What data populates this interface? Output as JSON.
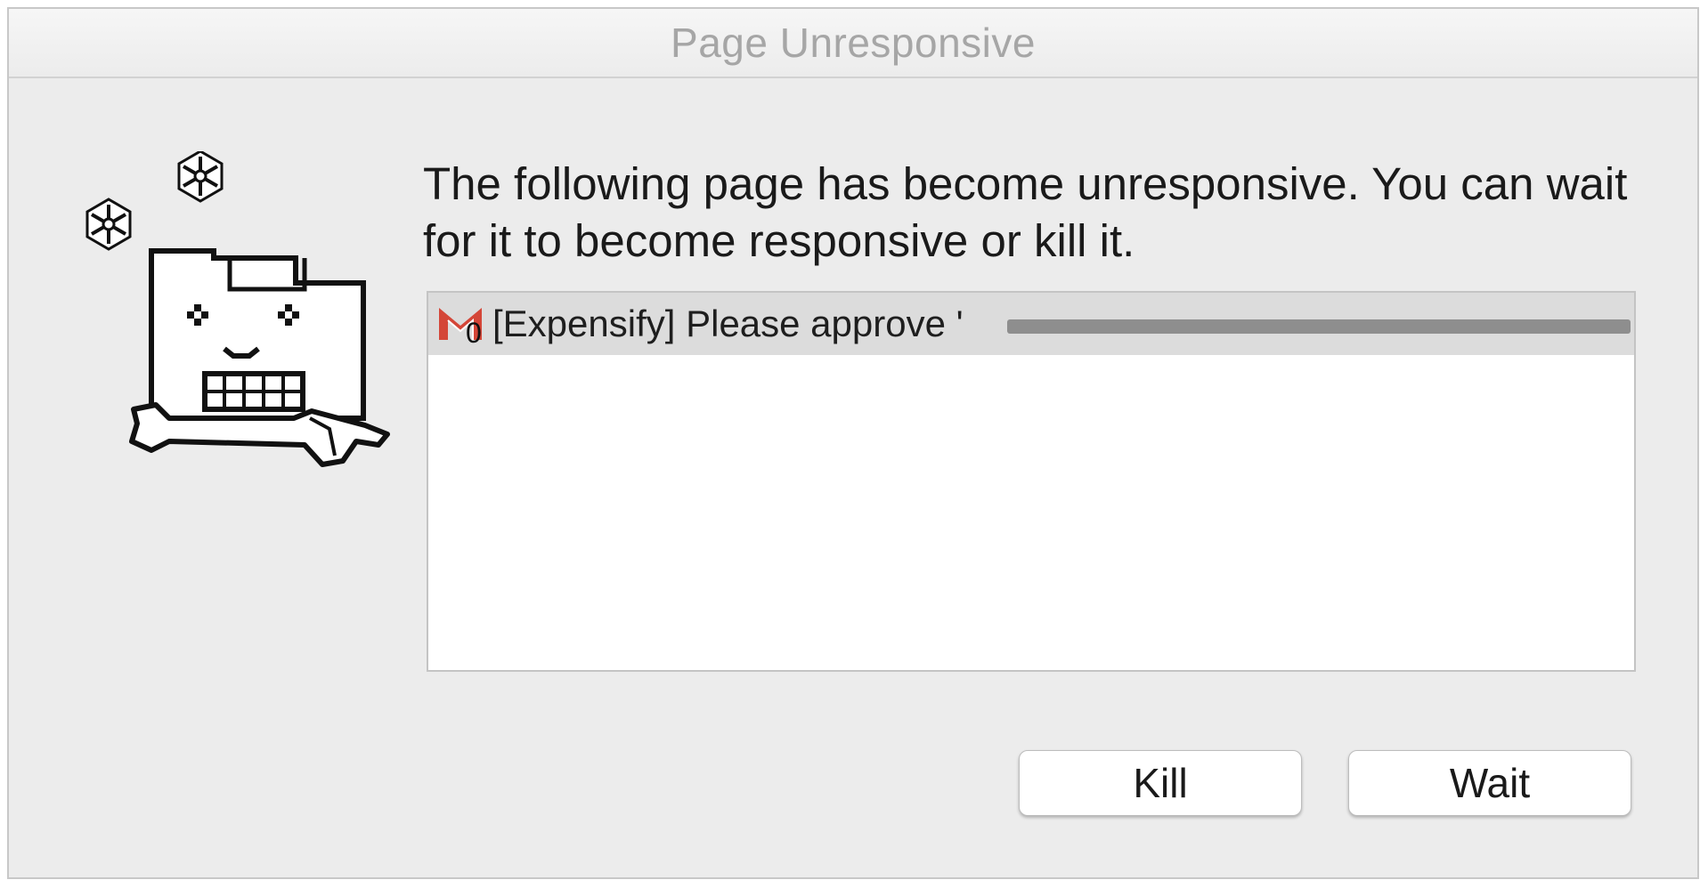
{
  "window": {
    "title": "Page Unresponsive"
  },
  "dialog": {
    "message": "The following page has become unresponsive. You can wait for it to become responsive or kill it.",
    "pages": [
      {
        "favicon": "gmail-icon",
        "badge": "0",
        "title": "[Expensify] Please approve '"
      }
    ],
    "buttons": {
      "kill_label": "Kill",
      "wait_label": "Wait"
    }
  },
  "icons": {
    "mascot": "frozen-page-mascot-icon",
    "snowflake": "snowflake-icon"
  },
  "colors": {
    "gmail_red": "#d44638",
    "selected_row": "#dcdcdc",
    "dialog_bg": "#ececec"
  }
}
